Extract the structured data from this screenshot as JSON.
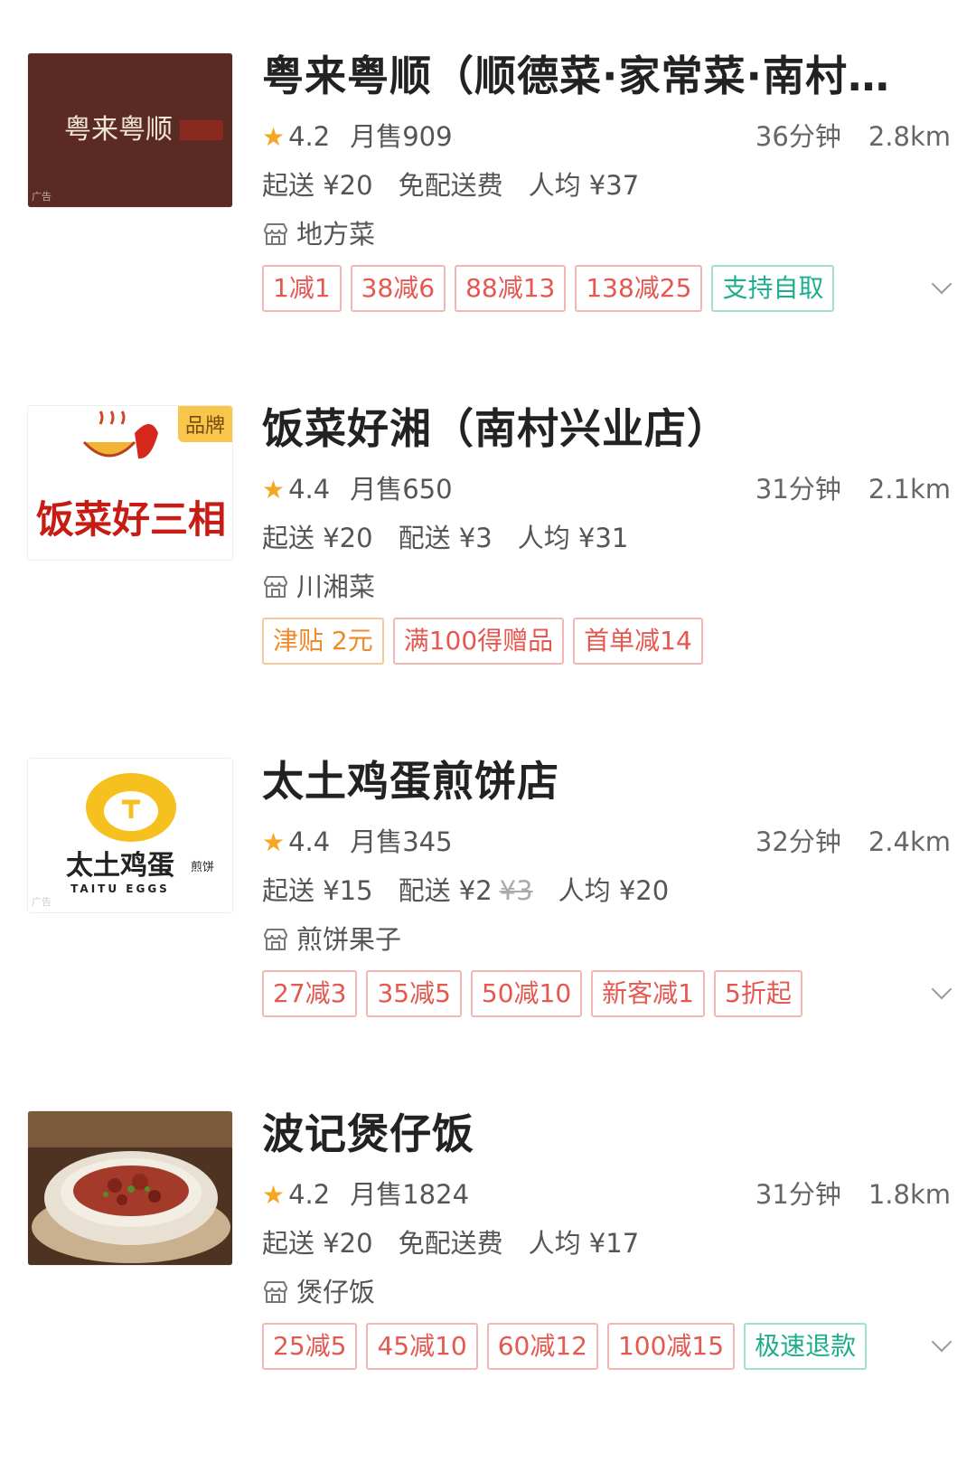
{
  "stores": [
    {
      "name": "粤来粤顺（顺德菜·家常菜·南村…",
      "rating": "4.2",
      "monthly_sales": "月售909",
      "time": "36分钟",
      "distance": "2.8km",
      "min_order": "起送 ¥20",
      "delivery": "免配送费",
      "per_capita": "人均 ¥37",
      "category": "地方菜",
      "thumb_text": "粤来粤顺",
      "ad_label": "广告",
      "tags": [
        {
          "text": "1减1",
          "color": "red"
        },
        {
          "text": "38减6",
          "color": "red"
        },
        {
          "text": "88减13",
          "color": "red"
        },
        {
          "text": "138减25",
          "color": "red"
        },
        {
          "text": "支持自取",
          "color": "green"
        }
      ]
    },
    {
      "name": "饭菜好湘（南村兴业店）",
      "rating": "4.4",
      "monthly_sales": "月售650",
      "time": "31分钟",
      "distance": "2.1km",
      "min_order": "起送 ¥20",
      "delivery": "配送 ¥3",
      "per_capita": "人均 ¥31",
      "category": "川湘菜",
      "brand_badge": "品牌",
      "thumb_text": "饭菜好三相",
      "tags": [
        {
          "text": "津贴 2元",
          "color": "orange"
        },
        {
          "text": "满100得赠品",
          "color": "red"
        },
        {
          "text": "首单减14",
          "color": "red"
        }
      ]
    },
    {
      "name": "太土鸡蛋煎饼店",
      "rating": "4.4",
      "monthly_sales": "月售345",
      "time": "32分钟",
      "distance": "2.4km",
      "min_order": "起送 ¥15",
      "delivery": "配送 ¥2",
      "delivery_original": "¥3",
      "per_capita": "人均 ¥20",
      "category": "煎饼果子",
      "thumb_text": "太土鸡蛋",
      "thumb_sub": "TAITU EGGS",
      "thumb_small": "煎饼",
      "ad_label": "广告",
      "tags": [
        {
          "text": "27减3",
          "color": "red"
        },
        {
          "text": "35减5",
          "color": "red"
        },
        {
          "text": "50减10",
          "color": "red"
        },
        {
          "text": "新客减1",
          "color": "red"
        },
        {
          "text": "5折起",
          "color": "red"
        }
      ]
    },
    {
      "name": "波记煲仔饭",
      "rating": "4.2",
      "monthly_sales": "月售1824",
      "time": "31分钟",
      "distance": "1.8km",
      "min_order": "起送 ¥20",
      "delivery": "免配送费",
      "per_capita": "人均 ¥17",
      "category": "煲仔饭",
      "tags": [
        {
          "text": "25减5",
          "color": "red"
        },
        {
          "text": "45减10",
          "color": "red"
        },
        {
          "text": "60减12",
          "color": "red"
        },
        {
          "text": "100减15",
          "color": "red"
        },
        {
          "text": "极速退款",
          "color": "green"
        }
      ]
    }
  ],
  "icons": {
    "star": "star-icon",
    "shop": "shop-icon",
    "expand": "chevron-down-icon"
  }
}
